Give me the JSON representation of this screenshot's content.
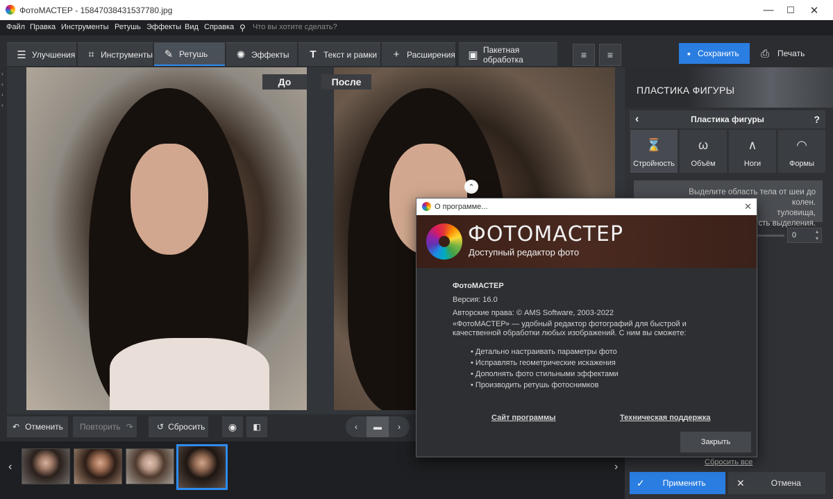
{
  "titlebar": {
    "title": "ФотоМАСТЕР - 15847038431537780.jpg",
    "minimize": "—",
    "maximize": "☐",
    "close": "✕"
  },
  "menu": {
    "items": [
      "Файл",
      "Правка",
      "Инструменты",
      "Ретушь",
      "Эффекты",
      "Вид",
      "Справка"
    ],
    "search_placeholder": "Что вы хотите сделать?"
  },
  "tabs": [
    "Улучшения",
    "Инструменты",
    "Ретушь",
    "Эффекты",
    "Текст и рамки",
    "Расширения",
    "Пакетная обработка"
  ],
  "actions": {
    "save": "Сохранить",
    "print": "Печать"
  },
  "preview": {
    "before": "До",
    "after": "После"
  },
  "bottom": {
    "undo": "Отменить",
    "redo": "Повторить",
    "reset": "Сбросить"
  },
  "panel": {
    "header": "ПЛАСТИКА ФИГУРЫ",
    "subheader": "Пластика фигуры",
    "help": "?",
    "tabs": [
      "Стройность",
      "Объём",
      "Ноги",
      "Формы"
    ],
    "hint_lines": [
      "Выделите область тела от шеи до колен.",
      "туловища,",
      "сть выделения."
    ],
    "slider_value": "0",
    "reset_all": "Сбросить все",
    "apply": "Применить",
    "cancel": "Отмена"
  },
  "dialog": {
    "title": "О программе...",
    "logo_text": "ФОТОМАСТЕР",
    "tagline": "Доступный редактор фото",
    "product": "ФотоМАСТЕР",
    "version": "Версия: 16.0",
    "copyright": "Авторские права: © AMS Software, 2003-2022",
    "description_line1": "«ФотоМАСТЕР» — удобный редактор фотографий для быстрой и",
    "description_line2": "качественной обработки любых изображений. С ним вы сможете:",
    "features": [
      "• Детально настраивать параметры фото",
      "• Исправлять геометрические искажения",
      "• Дополнять фото стильными эффектами",
      "• Производить ретушь фотоснимков"
    ],
    "link_site": "Сайт программы",
    "link_support": "Техническая поддержка",
    "close_button": "Закрыть"
  }
}
